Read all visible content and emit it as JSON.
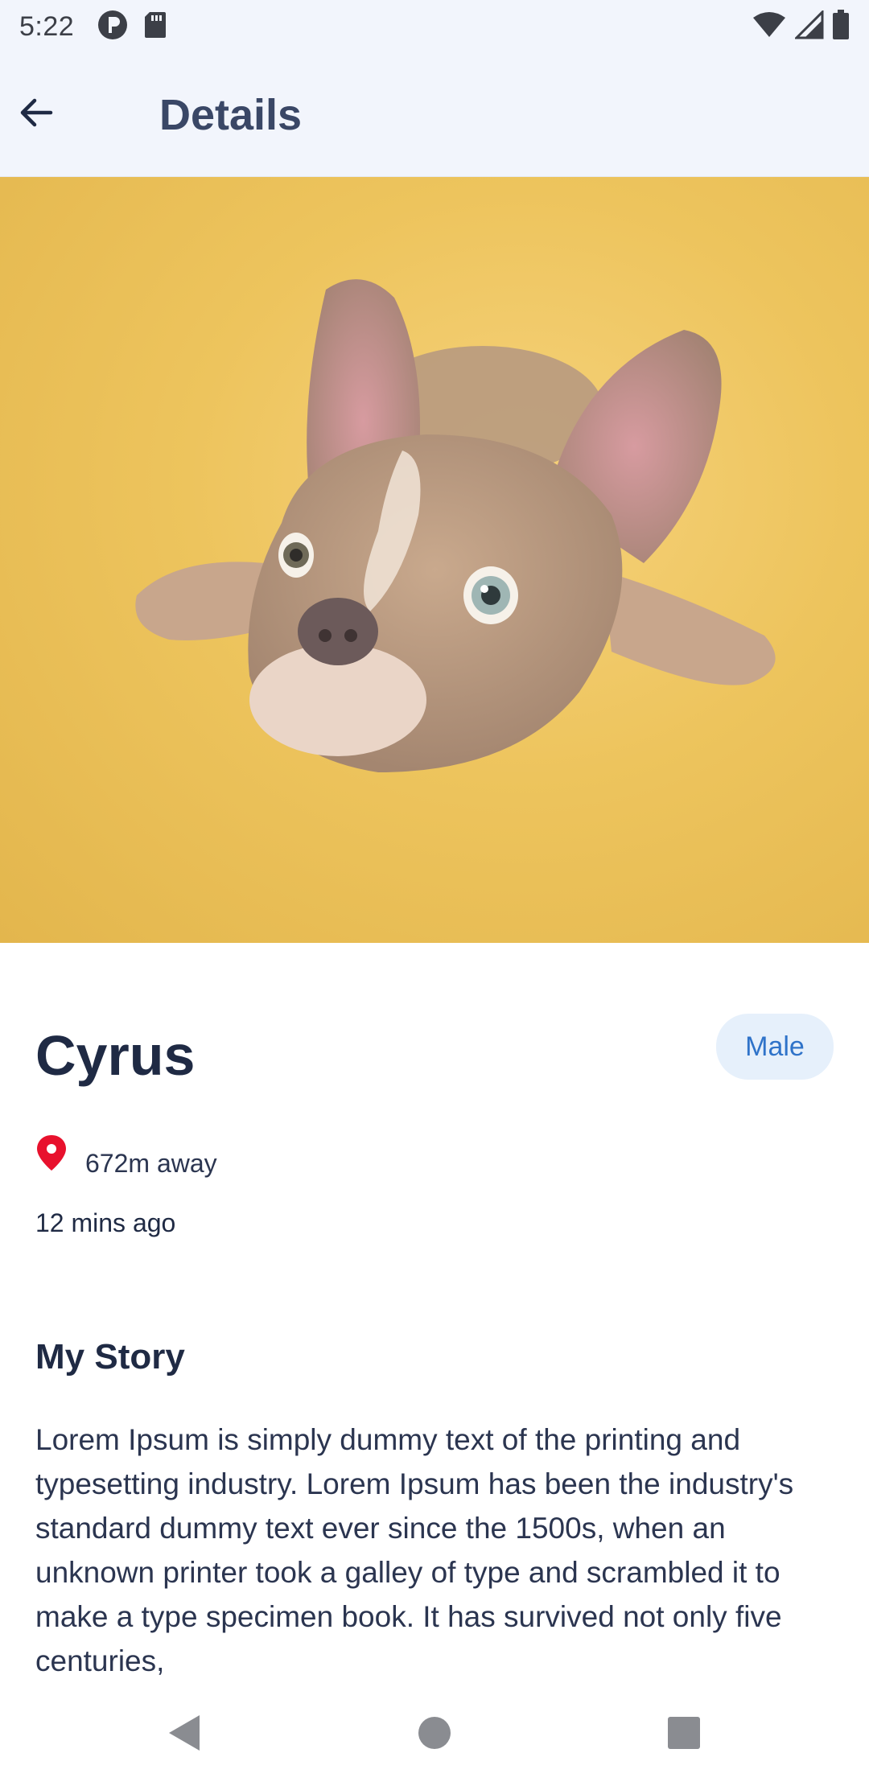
{
  "status_bar": {
    "time": "5:22",
    "left_icons": [
      "notification-p-icon",
      "sd-card-icon"
    ],
    "right_icons": [
      "wifi-icon",
      "cellular-signal-icon",
      "battery-icon"
    ]
  },
  "app_bar": {
    "back_icon": "arrow-left-icon",
    "title": "Details"
  },
  "hero": {
    "subject": "puppy photo",
    "background_color": "#edc45d"
  },
  "pet": {
    "name": "Cyrus",
    "gender": "Male",
    "distance": "672m away",
    "posted": "12 mins ago"
  },
  "story": {
    "title": "My Story",
    "text": "Lorem Ipsum is simply dummy text of the printing and typesetting industry. Lorem Ipsum has been the industry's standard dummy text ever since the 1500s, when an unknown printer took a galley of type and scrambled it to make a type specimen book. It has survived not only five centuries,"
  },
  "nav_bar": {
    "back_icon": "triangle-back-icon",
    "home_icon": "circle-home-icon",
    "recents_icon": "square-recents-icon"
  },
  "colors": {
    "app_bar_bg": "#f2f5fc",
    "title_text": "#1f2a44",
    "chip_bg": "#e6f0fb",
    "chip_text": "#2f73c9",
    "pin": "#e8112d"
  }
}
